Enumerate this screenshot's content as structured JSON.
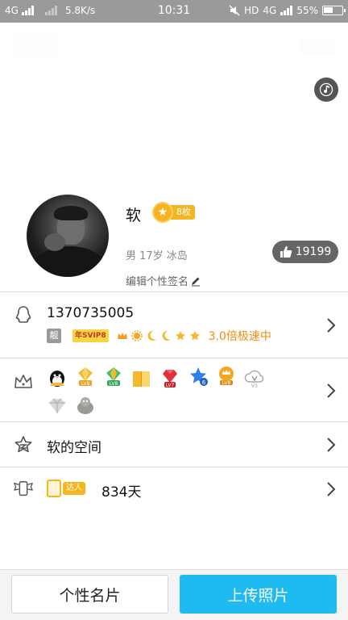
{
  "status_bar": {
    "network1": "4G",
    "speed": "5.8K/s",
    "time": "10:31",
    "hd": "HD",
    "network2": "4G",
    "battery": "55%",
    "battery_level": 0.55
  },
  "profile": {
    "nickname": "软",
    "medal_count": "8枚",
    "info": "男 17岁 冰岛",
    "signature_edit": "编辑个性签名",
    "likes": "19199"
  },
  "qq_row": {
    "number": "1370735005",
    "liang_tag": "靓",
    "svip_tag": "年SVIP8",
    "speed_text": "3.0倍极速中"
  },
  "game_icons": {
    "row1": [
      "qq-penguin-icon",
      "diamond-lv8-icon",
      "diamond-lv8-green-icon",
      "book-icon",
      "gem-lv7-icon",
      "star-6-icon",
      "crown-lv8-icon",
      "v3-icon"
    ],
    "row2": [
      "diamond-gray-icon",
      "bird-icon"
    ]
  },
  "qzone_row": {
    "label": "软的空间"
  },
  "daren_row": {
    "tag": "达人",
    "days": "834天"
  },
  "bottom": {
    "card_button": "个性名片",
    "upload_button": "上传照片"
  },
  "colors": {
    "accent_blue": "#1ebaf0",
    "gold": "#f4b51e",
    "speed_orange": "#f08c10"
  }
}
